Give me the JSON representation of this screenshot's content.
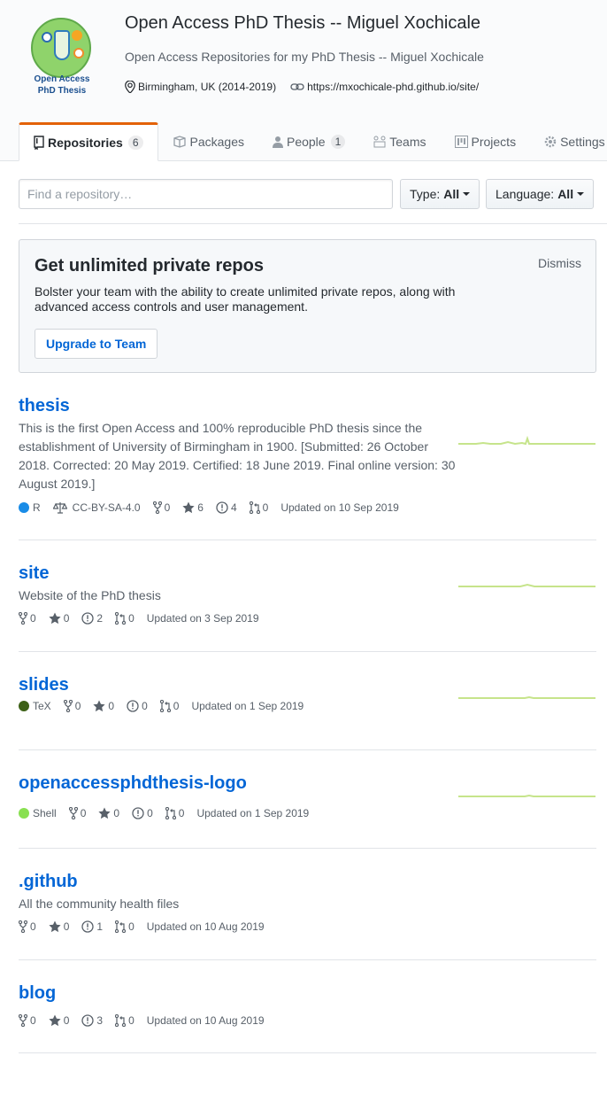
{
  "org": {
    "title": "Open Access PhD Thesis -- Miguel Xochicale",
    "description": "Open Access Repositories for my PhD Thesis -- Miguel Xochicale",
    "location": "Birmingham, UK (2014-2019)",
    "url": "https://mxochicale-phd.github.io/site/",
    "logo_text_line1": "Open Access",
    "logo_text_line2": "PhD Thesis"
  },
  "tabs": [
    {
      "label": "Repositories",
      "count": "6",
      "icon": "repo-icon"
    },
    {
      "label": "Packages",
      "icon": "package-icon"
    },
    {
      "label": "People",
      "count": "1",
      "icon": "person-icon"
    },
    {
      "label": "Teams",
      "icon": "team-icon"
    },
    {
      "label": "Projects",
      "icon": "project-icon"
    },
    {
      "label": "Settings",
      "icon": "gear-icon"
    }
  ],
  "filters": {
    "search_placeholder": "Find a repository…",
    "type_label": "Type:",
    "type_value": "All",
    "language_label": "Language:",
    "language_value": "All"
  },
  "upsell": {
    "title": "Get unlimited private repos",
    "body": "Bolster your team with the ability to create unlimited private repos, along with advanced access controls and user management.",
    "dismiss": "Dismiss",
    "button": "Upgrade to Team"
  },
  "repos": [
    {
      "name": "thesis",
      "description": "This is the first Open Access and 100% reproducible PhD thesis since the establishment of University of Birmingham in 1900. [Submitted: 26 October 2018. Corrected: 20 May 2019. Certified: 18 June 2019. Final online version: 30 August 2019.]",
      "language": "R",
      "language_color": "#198ce7",
      "license": "CC-BY-SA-4.0",
      "forks": "0",
      "stars": "6",
      "issues": "4",
      "prs": "0",
      "updated": "Updated on 10 Sep 2019"
    },
    {
      "name": "site",
      "description": "Website of the PhD thesis",
      "forks": "0",
      "stars": "0",
      "issues": "2",
      "prs": "0",
      "updated": "Updated on 3 Sep 2019"
    },
    {
      "name": "slides",
      "language": "TeX",
      "language_color": "#3d6117",
      "forks": "0",
      "stars": "0",
      "issues": "0",
      "prs": "0",
      "updated": "Updated on 1 Sep 2019"
    },
    {
      "name": "openaccessphdthesis-logo",
      "language": "Shell",
      "language_color": "#89e051",
      "forks": "0",
      "stars": "0",
      "issues": "0",
      "prs": "0",
      "updated": "Updated on 1 Sep 2019"
    },
    {
      "name": ".github",
      "description": "All the community health files",
      "forks": "0",
      "stars": "0",
      "issues": "1",
      "prs": "0",
      "updated": "Updated on 10 Aug 2019"
    },
    {
      "name": "blog",
      "forks": "0",
      "stars": "0",
      "issues": "3",
      "prs": "0",
      "updated": "Updated on 10 Aug 2019"
    }
  ],
  "colors": {
    "link": "#0366d6",
    "accent_tab": "#e36209",
    "sparkline": "#c6e48b"
  }
}
